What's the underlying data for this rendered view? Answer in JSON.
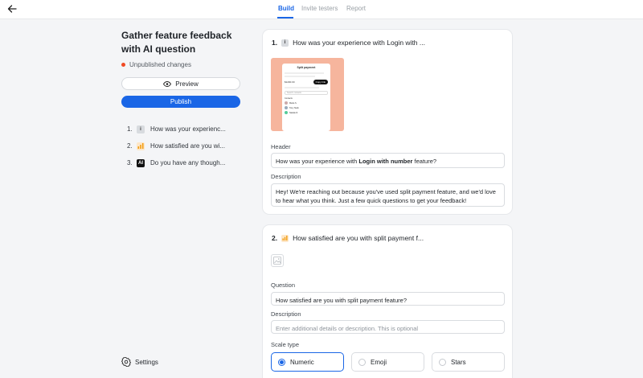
{
  "colors": {
    "accent": "#1a66e6",
    "unpublished_dot": "#f04a24",
    "thumb_bg": "#f6b59d"
  },
  "nav": {
    "back_icon": "arrow-left-icon",
    "tabs": [
      {
        "label": "Build",
        "active": true
      },
      {
        "label": "Invite testers",
        "active": false
      },
      {
        "label": "Report",
        "active": false
      }
    ]
  },
  "sidebar": {
    "title": "Gather feature feedback with AI question",
    "status": "Unpublished changes",
    "preview_label": "Preview",
    "publish_label": "Publish",
    "questions": [
      {
        "num": "1.",
        "icon": "info-icon",
        "icon_text": "i",
        "text": "How was your experienc..."
      },
      {
        "num": "2.",
        "icon": "bar-chart-icon",
        "icon_text": "",
        "text": "How satisfied are you wi..."
      },
      {
        "num": "3.",
        "icon": "ai-icon",
        "icon_text": "AI",
        "text": "Do you have any though..."
      }
    ],
    "settings_label": "Settings"
  },
  "card1": {
    "num": "1.",
    "icon_text": "i",
    "heading": "How was your experience with Login with ...",
    "thumbnail": {
      "title": "Split payment",
      "amount": "$1200.00",
      "button": "Copy link",
      "search": "Search contacts",
      "section": "Contacts",
      "contacts": [
        "Maria S.",
        "Tony Stark",
        "Natalie R."
      ]
    },
    "header_label": "Header",
    "header_prefix": "How was your experience with ",
    "header_bold": "Login with number",
    "header_suffix": " feature?",
    "description_label": "Description",
    "description_value": "Hey! We're reaching out because you've used split payment feature, and we'd love to hear what you think. Just a few quick questions to get your feedback!"
  },
  "card2": {
    "num": "2.",
    "heading": "How satisfied are you with split payment f...",
    "question_label": "Question",
    "question_value": "How satisfied are you with split payment feature?",
    "description_label": "Description",
    "description_placeholder": "Enter additional details or description. This is optional",
    "scale_label": "Scale type",
    "scale_options": [
      {
        "label": "Numeric",
        "selected": true
      },
      {
        "label": "Emoji",
        "selected": false
      },
      {
        "label": "Stars",
        "selected": false
      }
    ]
  }
}
